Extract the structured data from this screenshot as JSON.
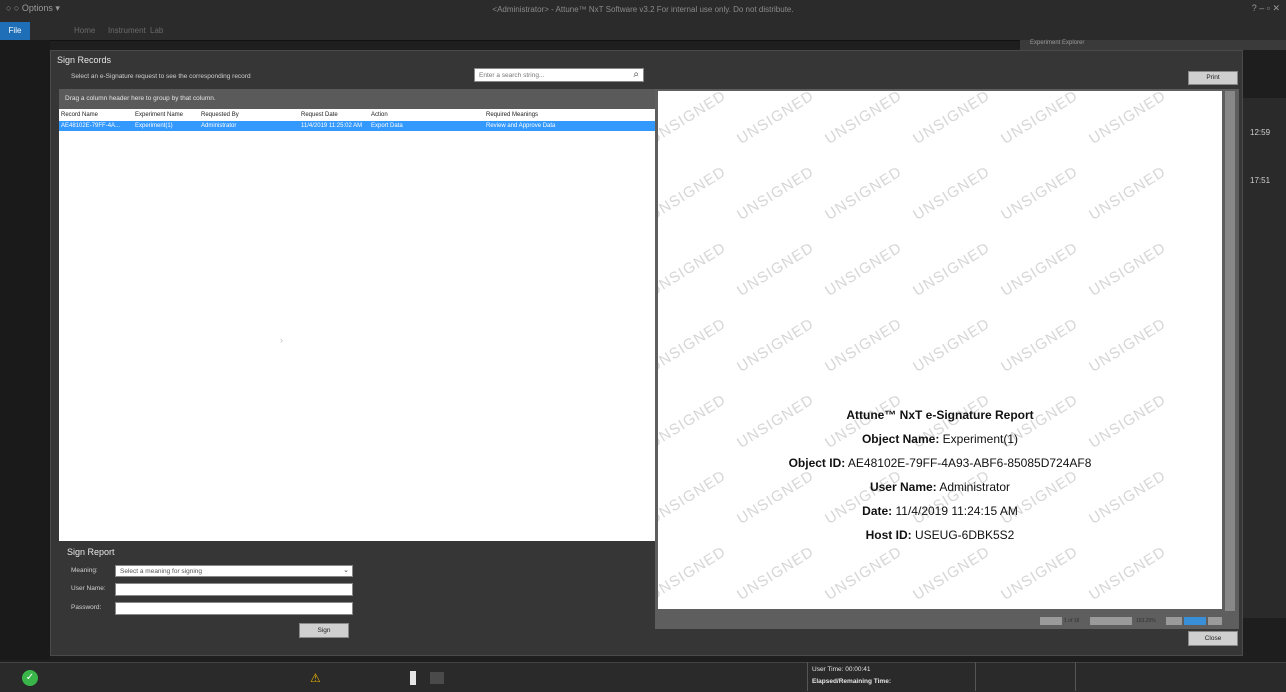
{
  "app": {
    "title": "<Administrator> - Attune™ NxT Software v3.2 For internal use only. Do not distribute.",
    "quick_access": "○ ○  Options ▾",
    "window_controls": "? – ▫ ✕"
  },
  "ribbon": {
    "file": "File",
    "tabs": [
      "Home",
      "Instrument",
      "Lab"
    ]
  },
  "background": {
    "header": "Experiment Explorer",
    "times": [
      "12:59",
      "17:51"
    ]
  },
  "dialog": {
    "title": "Sign Records",
    "hint": "Select an e-Signature request to see the corresponding record",
    "search_placeholder": "Enter a search string...",
    "group_hint": "Drag a column header here to group by that column.",
    "columns": [
      "Record Name",
      "Experiment Name",
      "Requested By",
      "Request Date",
      "Action",
      "Required Meanings"
    ],
    "rows": [
      {
        "record_name": "AE48102E-79FF-4A...",
        "experiment_name": "Experiment(1)",
        "requested_by": "Administrator",
        "request_date": "11/4/2019 11:25:02 AM",
        "action": "Export Data",
        "required_meanings": "Review and Approve Data"
      }
    ],
    "sign_report": {
      "title": "Sign Report",
      "meaning_label": "Meaning:",
      "meaning_value": "Select a meaning for signing",
      "user_label": "User Name:",
      "password_label": "Password:",
      "sign_button": "Sign"
    },
    "print_button": "Print",
    "close_button": "Close"
  },
  "report": {
    "watermark": "UNSIGNED",
    "title": "Attune™ NxT e-Signature Report",
    "object_name_label": "Object Name:",
    "object_name": "Experiment(1)",
    "object_id_label": "Object ID:",
    "object_id": "AE48102E-79FF-4A93-ABF6-85085D724AF8",
    "user_name_label": "User Name:",
    "user_name": "Administrator",
    "date_label": "Date:",
    "date": "11/4/2019 11:24:15 AM",
    "host_id_label": "Host ID:",
    "host_id": "USEUG-6DBK5S2",
    "pager_text": "1 of 18",
    "zoom_text": "163.25%"
  },
  "status": {
    "user_time": "User Time: 00:00:41",
    "elapsed": "Elapsed/Remaining Time:"
  },
  "colors": {
    "selection": "#3399ff",
    "ok": "#39b54a",
    "file_tab": "#1f6fb8"
  }
}
